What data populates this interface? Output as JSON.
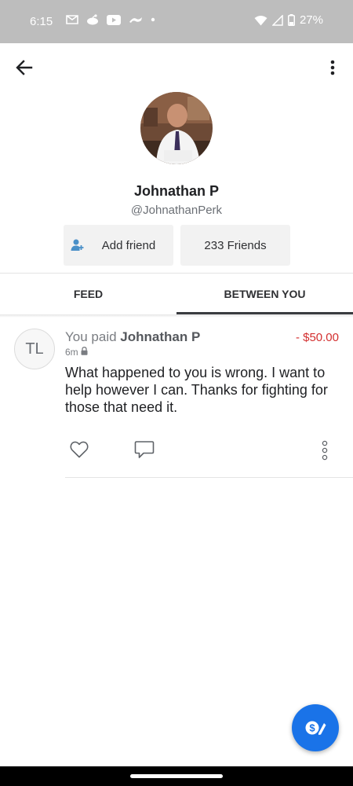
{
  "status_bar": {
    "time": "6:15",
    "battery": "27%",
    "icons_left": [
      "gmail-icon",
      "reddit-icon",
      "youtube-icon",
      "app-icon",
      "dot-icon"
    ],
    "icons_right": [
      "wifi-icon",
      "signal-icon",
      "battery-icon"
    ]
  },
  "top_bar": {
    "back_icon": "arrow-left-icon",
    "more_icon": "more-vert-icon"
  },
  "profile": {
    "name": "Johnathan P",
    "handle": "@JohnathanPerk",
    "add_friend_label": "Add friend",
    "friends_label": "233 Friends"
  },
  "tabs": {
    "feed": "FEED",
    "between_you": "BETWEEN YOU",
    "selected": "BETWEEN YOU"
  },
  "story": {
    "avatar_initials": "TL",
    "prefix": "You paid",
    "recipient": "Johnathan P",
    "amount": "- $50.00",
    "time": "6m",
    "privacy_icon": "lock-icon",
    "note": "What happened to you is wrong. I want to help however I can. Thanks for fighting for those that need it."
  },
  "colors": {
    "status_bar": "#bdbdbd",
    "amount_red": "#d32f2f",
    "fab_blue": "#1a73e8",
    "button_bg": "#f2f2f2"
  }
}
